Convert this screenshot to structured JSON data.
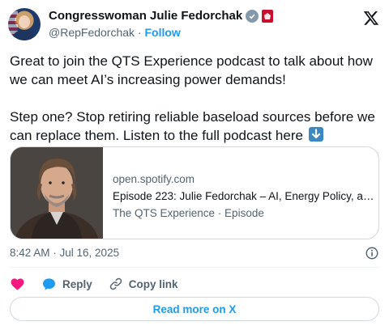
{
  "author": {
    "name": "Congresswoman Julie Fedorchak",
    "handle": "@RepFedorchak",
    "separator": "·",
    "follow_label": "Follow",
    "verified_color": "#829aab",
    "affiliation_color": "#c8102e"
  },
  "brand_icon": "x-logo-icon",
  "tweet": {
    "paragraph1": "Great to join the QTS Experience podcast to talk about how we can meet AI’s increasing power demands!",
    "paragraph2": "Step one? Stop retiring reliable baseload sources before we can replace them. Listen to the full podcast here",
    "emoji_icon": "down-arrow-emoji-icon"
  },
  "link_card": {
    "domain": "open.spotify.com",
    "title": "Episode 223: Julie Fedorchak – AI, Energy Policy, and...",
    "subtitle": "The QTS Experience · Episode"
  },
  "meta": {
    "timestamp": "8:42 AM · Jul 16, 2025"
  },
  "actions": {
    "reply_label": "Reply",
    "copy_link_label": "Copy link",
    "like_color": "#f91880",
    "reply_color": "#1d9bf0"
  },
  "read_more_label": "Read more on X",
  "colors": {
    "accent": "#1d9bf0",
    "text": "#0f1419",
    "secondary": "#536471",
    "border": "#cfd9de"
  }
}
